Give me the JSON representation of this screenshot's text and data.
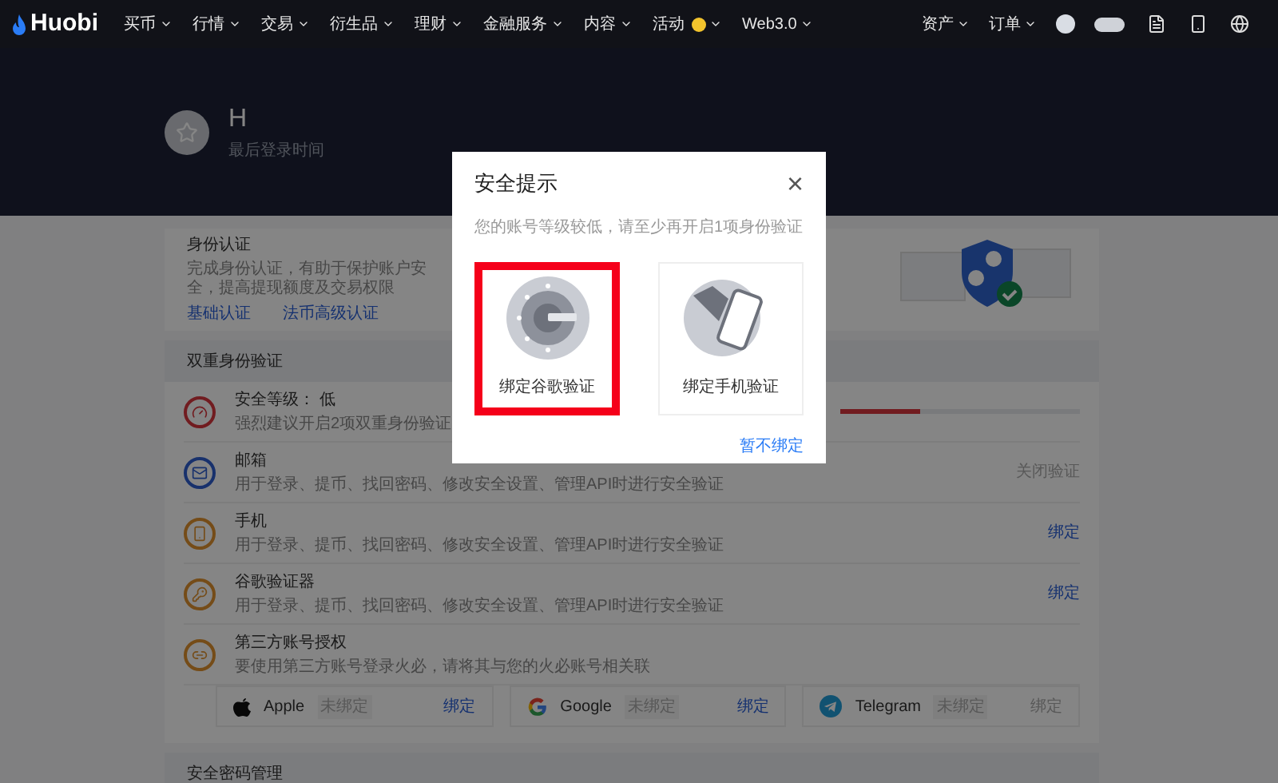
{
  "nav": {
    "logo": "Huobi",
    "menu": [
      {
        "label": "买币",
        "kind": "plain"
      },
      {
        "label": "行情",
        "kind": "plain"
      },
      {
        "label": "交易",
        "kind": "plain"
      },
      {
        "label": "衍生品",
        "kind": "plain"
      },
      {
        "label": "理财",
        "kind": "plain"
      },
      {
        "label": "金融服务",
        "kind": "plain"
      },
      {
        "label": "内容",
        "kind": "plain"
      },
      {
        "label": "活动",
        "kind": "coin"
      },
      {
        "label": "Web3.0",
        "kind": "plain"
      }
    ],
    "right": [
      "资产",
      "订单"
    ]
  },
  "profile": {
    "name": "H",
    "subtitle": "最后登录时间"
  },
  "identity": {
    "title": "身份认证",
    "description": "完成身份认证，有助于保护账户安全，提高提现额度及交易权限",
    "links": [
      "基础认证",
      "法币高级认证"
    ]
  },
  "two_factor": {
    "title": "双重身份验证",
    "rows": [
      {
        "kind": "level",
        "title": "安全等级： 低",
        "description": "强烈建议开启2项双重身份验证",
        "level": 0.33
      },
      {
        "kind": "email",
        "title": "邮箱",
        "description": "用于登录、提币、找回密码、修改安全设置、管理API时进行安全验证",
        "action": "关闭验证",
        "action_active": false
      },
      {
        "kind": "phone",
        "title": "手机",
        "description": "用于登录、提币、找回密码、修改安全设置、管理API时进行安全验证",
        "action": "绑定",
        "action_active": true
      },
      {
        "kind": "authenticator",
        "title": "谷歌验证器",
        "description": "用于登录、提币、找回密码、修改安全设置、管理API时进行安全验证",
        "action": "绑定",
        "action_active": true
      },
      {
        "kind": "link",
        "title": "第三方账号授权",
        "description": "要使用第三方账号登录火必，请将其与您的火必账号相关联"
      }
    ],
    "accounts": [
      {
        "kind": "apple",
        "name": "Apple",
        "status": "未绑定",
        "action": "绑定",
        "action_active": true
      },
      {
        "kind": "google",
        "name": "Google",
        "status": "未绑定",
        "action": "绑定",
        "action_active": true
      },
      {
        "kind": "telegram",
        "name": "Telegram",
        "status": "未绑定",
        "action": "绑定",
        "action_active": false
      }
    ]
  },
  "password_section": {
    "title": "安全密码管理"
  },
  "dialog": {
    "title": "安全提示",
    "close": "×",
    "message": "您的账号等级较低，请至少再开启1项身份验证",
    "options": [
      {
        "kind": "authenticator",
        "label": "绑定谷歌验证",
        "highlighted": true
      },
      {
        "kind": "phone",
        "label": "绑定手机验证",
        "highlighted": false
      }
    ],
    "skip": "暂不绑定"
  }
}
